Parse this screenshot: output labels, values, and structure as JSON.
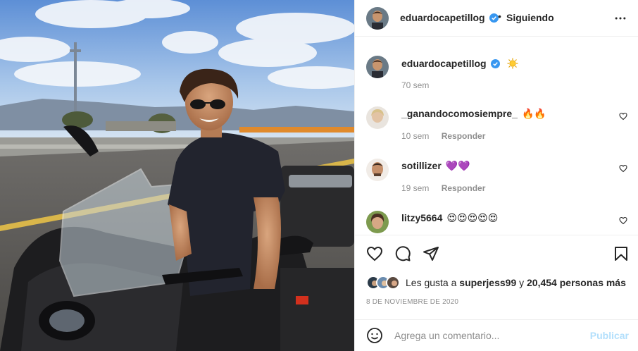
{
  "post": {
    "author": "eduardocapetillog",
    "follow_status": "Siguiendo",
    "dot": "•",
    "caption_time": "70 sem",
    "caption_emoji": "sun-emoji",
    "likes_prefix": "Les gusta a",
    "likes_user": "superjess99",
    "likes_mid": "y",
    "likes_count": "20,454 personas más",
    "date": "8 DE NOVIEMBRE DE 2020"
  },
  "comments": [
    {
      "user": "_ganandocomosiempre_",
      "emoji": "🔥🔥",
      "time": "10 sem",
      "reply": "Responder"
    },
    {
      "user": "sotillizer",
      "emoji": "💜💜",
      "time": "19 sem",
      "reply": "Responder"
    },
    {
      "user": "litzy5664",
      "emoji": "😍😍😍😍😍",
      "time": "",
      "reply": ""
    }
  ],
  "input": {
    "placeholder": "Agrega un comentario...",
    "publish_label": "Publicar"
  },
  "colors": {
    "verified": "#3897f0",
    "publish_disabled": "#b2dffc",
    "meta_text": "#8e8e8e"
  },
  "icons": [
    "more-icon",
    "verified-icon",
    "heart-icon",
    "comment-icon",
    "share-icon",
    "bookmark-icon",
    "smile-icon"
  ]
}
